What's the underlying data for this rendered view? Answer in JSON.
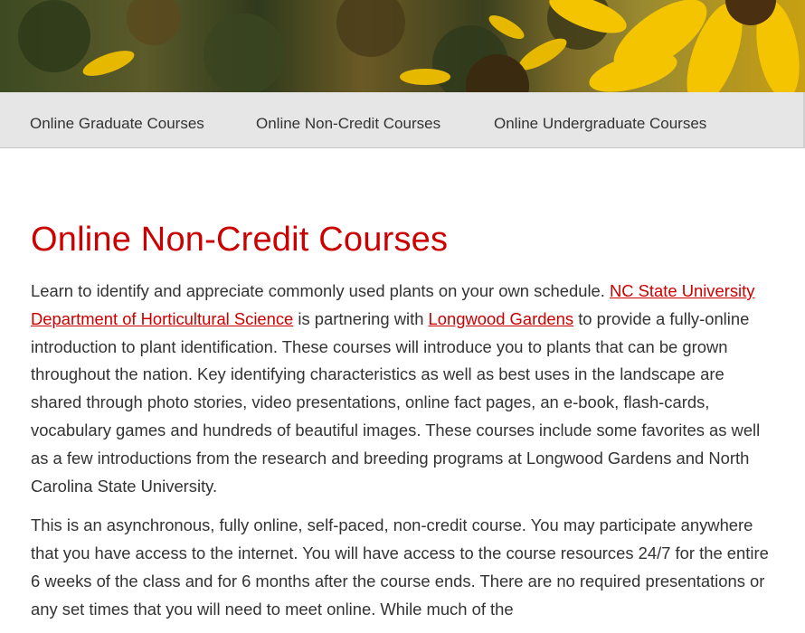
{
  "nav": {
    "items": [
      {
        "label": "Online Graduate Courses"
      },
      {
        "label": "Online Non-Credit Courses"
      },
      {
        "label": "Online Undergraduate Courses"
      }
    ]
  },
  "main": {
    "title": "Online Non-Credit Courses",
    "p1": {
      "t1": "Learn to identify and appreciate commonly used plants on your own schedule. ",
      "link_ncsu": "NC State University",
      "t2": " ",
      "link_hort": "Department of Horticultural Science",
      "t3": " is partnering with ",
      "link_longwood": "Longwood Gardens",
      "t4": " to provide a fully-online introduction to plant identification. These courses will introduce you to plants that can be grown throughout the nation. Key identifying characteristics as well as best uses in the landscape are shared through photo stories, video presentations, online fact pages, an e-book, flash-cards, vocabulary games and hundreds of beautiful images. These courses include some favorites as well as a few introductions from the research and breeding programs at Longwood Gardens and North Carolina State University."
    },
    "p2": "This is an asynchronous, fully online, self-paced, non-credit course.  You may participate anywhere that you have access to the internet.  You will have access to the course resources 24/7 for the entire 6 weeks of the class and for 6 months after the course ends.  There are no required presentations or any set times that you will need to meet online. While much of the"
  }
}
